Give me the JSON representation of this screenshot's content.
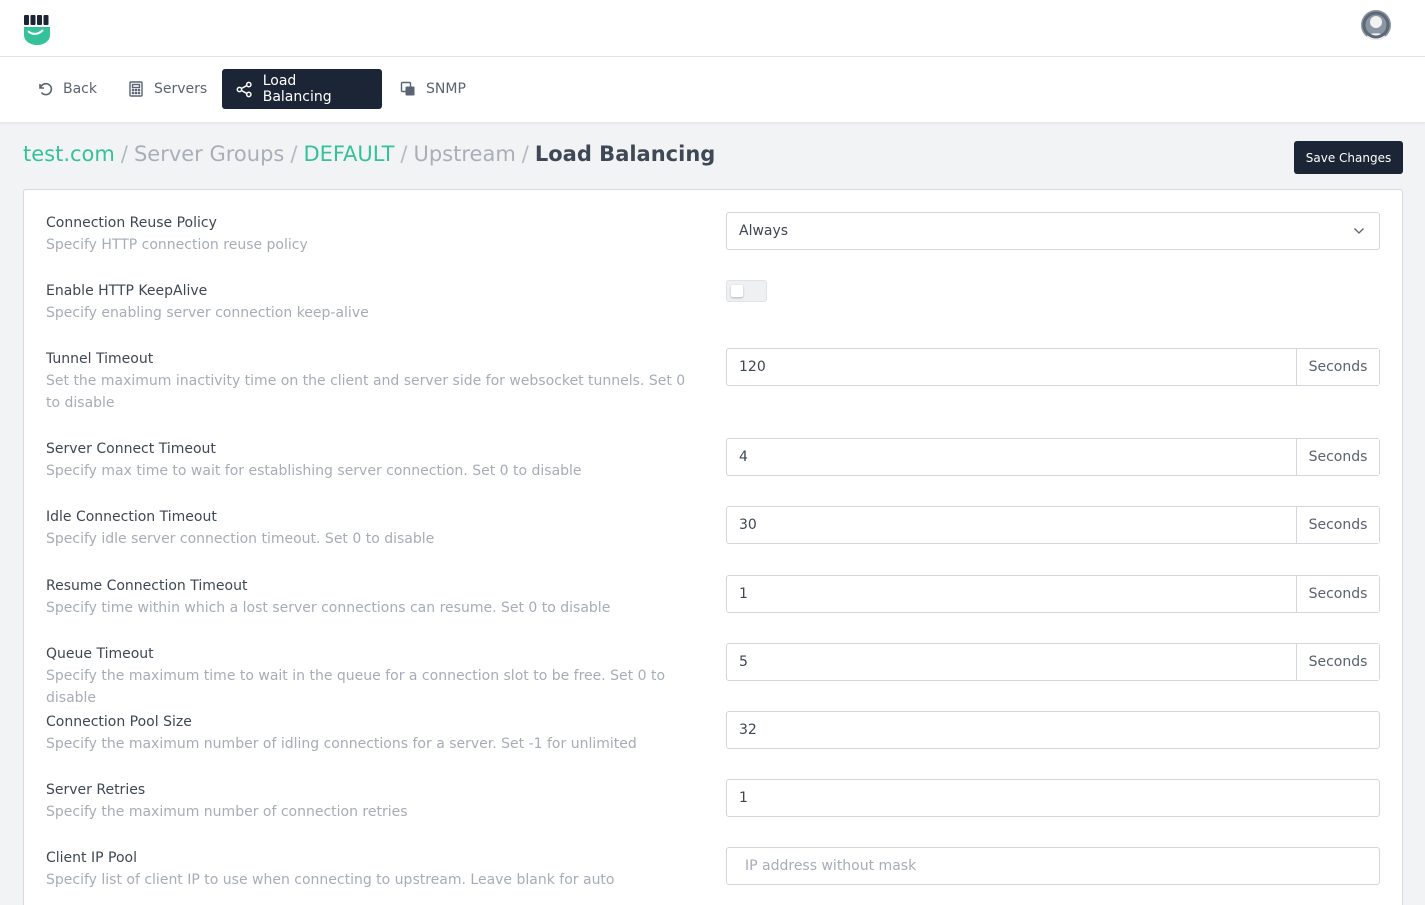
{
  "colors": {
    "brand": "#35c29b",
    "dark": "#1b2536"
  },
  "header": {
    "logo_icon": "fist-logo-icon",
    "avatar_icon": "user-avatar-icon"
  },
  "nav": {
    "back": "Back",
    "servers": "Servers",
    "load_balancing": "Load Balancing",
    "snmp": "SNMP"
  },
  "breadcrumb": {
    "domain": "test.com",
    "server_groups": "Server Groups",
    "group": "DEFAULT",
    "upstream": "Upstream",
    "current": "Load Balancing",
    "separator": "/"
  },
  "save_label": "Save Changes",
  "settings": {
    "reuse": {
      "title": "Connection Reuse Policy",
      "desc": "Specify HTTP connection reuse policy",
      "value": "Always"
    },
    "keepalive": {
      "title": "Enable HTTP KeepAlive",
      "desc": "Specify enabling server connection keep-alive",
      "enabled": false
    },
    "tunnel": {
      "title": "Tunnel Timeout",
      "desc": "Set the maximum inactivity time on the client and server side for websocket tunnels. Set 0 to disable",
      "value": "120",
      "unit": "Seconds"
    },
    "connect": {
      "title": "Server Connect Timeout",
      "desc": "Specify max time to wait for establishing server connection. Set 0 to disable",
      "value": "4",
      "unit": "Seconds"
    },
    "idle": {
      "title": "Idle Connection Timeout",
      "desc": "Specify idle server connection timeout. Set 0 to disable",
      "value": "30",
      "unit": "Seconds"
    },
    "resume": {
      "title": "Resume Connection Timeout",
      "desc": "Specify time within which a lost server connections can resume. Set 0 to disable",
      "value": "1",
      "unit": "Seconds"
    },
    "queue": {
      "title": "Queue Timeout",
      "desc": "Specify the maximum time to wait in the queue for a connection slot to be free. Set 0 to disable",
      "value": "5",
      "unit": "Seconds"
    },
    "pool": {
      "title": "Connection Pool Size",
      "desc": "Specify the maximum number of idling connections for a server. Set -1 for unlimited",
      "value": "32"
    },
    "retries": {
      "title": "Server Retries",
      "desc": "Specify the maximum number of connection retries",
      "value": "1"
    },
    "ippool": {
      "title": "Client IP Pool",
      "desc": "Specify list of client IP to use when connecting to upstream. Leave blank for auto",
      "placeholder": "IP address without mask",
      "value": ""
    }
  }
}
